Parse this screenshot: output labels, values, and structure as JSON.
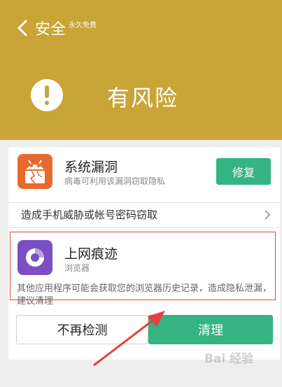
{
  "header": {
    "title": "安全",
    "tag": "永久免费",
    "status": "有风险",
    "bg_color": "#c9a437"
  },
  "items": [
    {
      "icon": "android-broken-icon",
      "title": "系统漏洞",
      "subtitle": "病毒可利用该漏洞窃取隐私",
      "action": "修复",
      "threat": "造成手机威胁或帐号密码窃取"
    },
    {
      "icon": "browser-icon",
      "title": "上网痕迹",
      "subtitle": "浏览器",
      "description": "其他应用程序可能会获取您的浏览器历史记录，造成隐私泄漏，建议清理",
      "secondary_action": "不再检测",
      "primary_action": "清理"
    }
  ],
  "watermark": "Bai 经验",
  "accent_green": "#35b483",
  "annotation_color": "#e84040"
}
